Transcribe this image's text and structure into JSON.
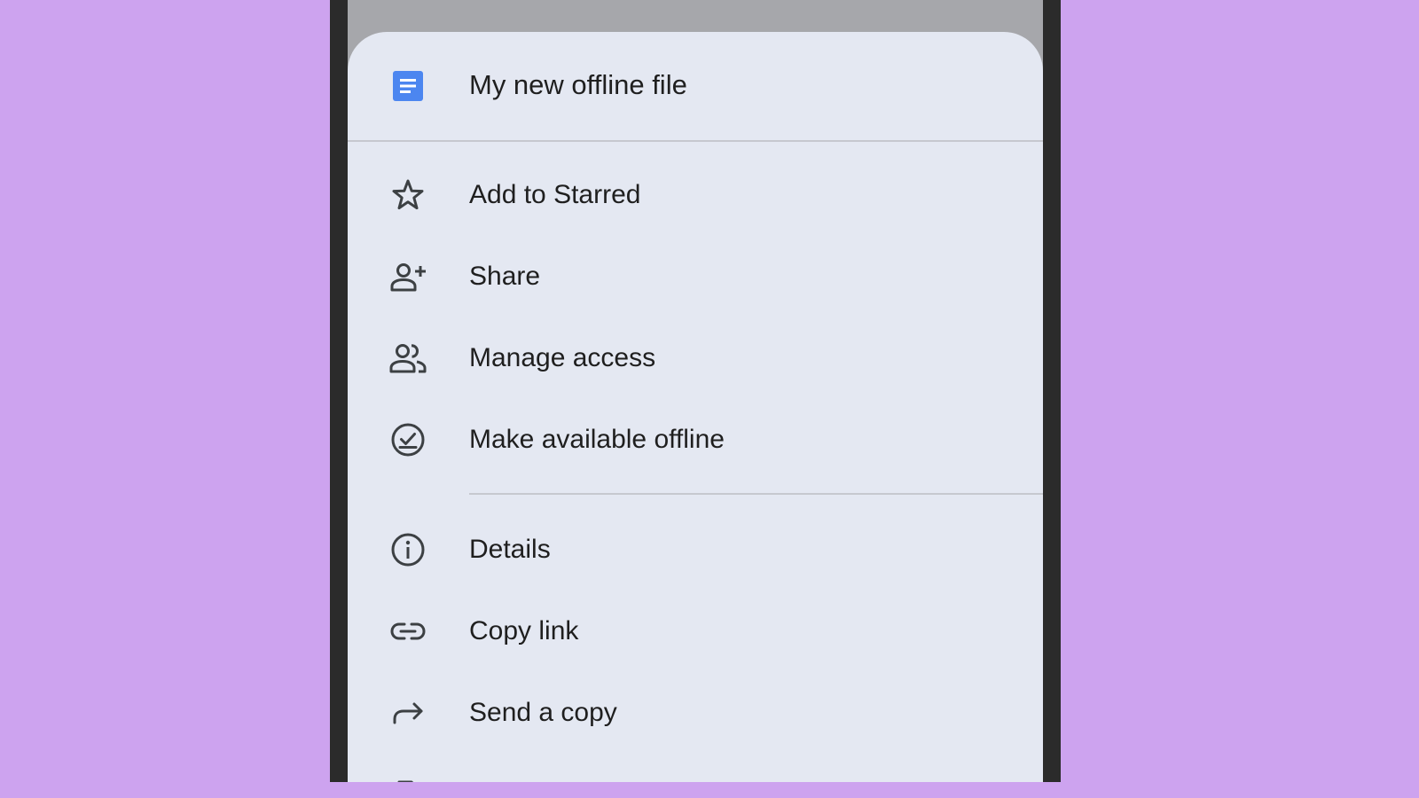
{
  "header": {
    "file_title": "My new offline file",
    "file_icon": "docs-file-icon",
    "accent_color": "#4c86f0"
  },
  "menu": {
    "items": [
      {
        "label": "Add to Starred",
        "icon": "star-outline-icon"
      },
      {
        "label": "Share",
        "icon": "person-add-icon"
      },
      {
        "label": "Manage access",
        "icon": "people-icon"
      },
      {
        "label": "Make available offline",
        "icon": "offline-check-icon"
      },
      {
        "label": "Details",
        "icon": "info-icon"
      },
      {
        "label": "Copy link",
        "icon": "link-icon"
      },
      {
        "label": "Send a copy",
        "icon": "forward-arrow-icon"
      }
    ]
  },
  "colors": {
    "background": "#cda3ef",
    "sheet": "#e4e8f2",
    "text": "#1f1f1f",
    "icon": "#3c4043"
  }
}
